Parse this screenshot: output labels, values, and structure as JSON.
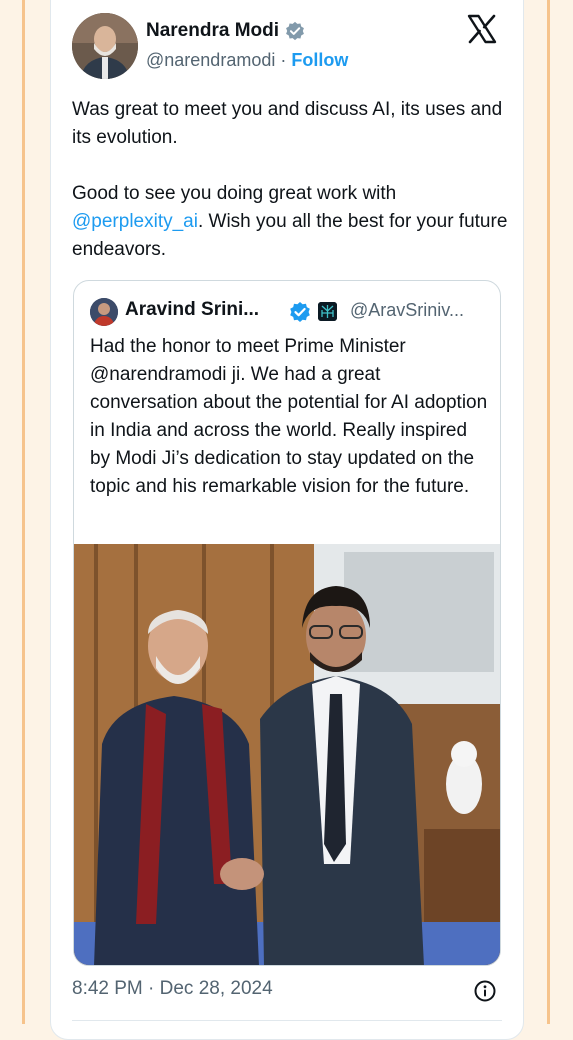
{
  "tweet": {
    "author_name": "Narendra Modi",
    "handle": "@narendramodi",
    "separator": "·",
    "follow_label": "Follow",
    "text_line1": "Was great to meet you and discuss AI, its uses and its evolution.",
    "text_line2_prefix": "Good to see you doing great work with ",
    "mention": "@perplexity_ai",
    "text_line2_suffix": ". Wish you all the best for your future endeavors.",
    "timestamp": "8:42 PM · Dec 28, 2024"
  },
  "quoted_tweet": {
    "author_name": "Aravind Srini...",
    "handle": "@AravSriniv...",
    "text": "Had the honor to meet Prime Minister @narendramodi ji. We had a great conversation about the potential for AI adoption in India and across the world. Really inspired by Modi Ji’s dedication to stay updated on the topic and his remarkable vision for the future."
  },
  "icons": {
    "platform_logo": "x-logo-icon",
    "verified": "verified-badge-icon",
    "affiliate": "affiliate-badge-icon",
    "info": "info-icon"
  },
  "colors": {
    "accent": "#1d9bf0",
    "text": "#0f1419",
    "secondary": "#536471",
    "page_background": "#fdf3e6"
  }
}
